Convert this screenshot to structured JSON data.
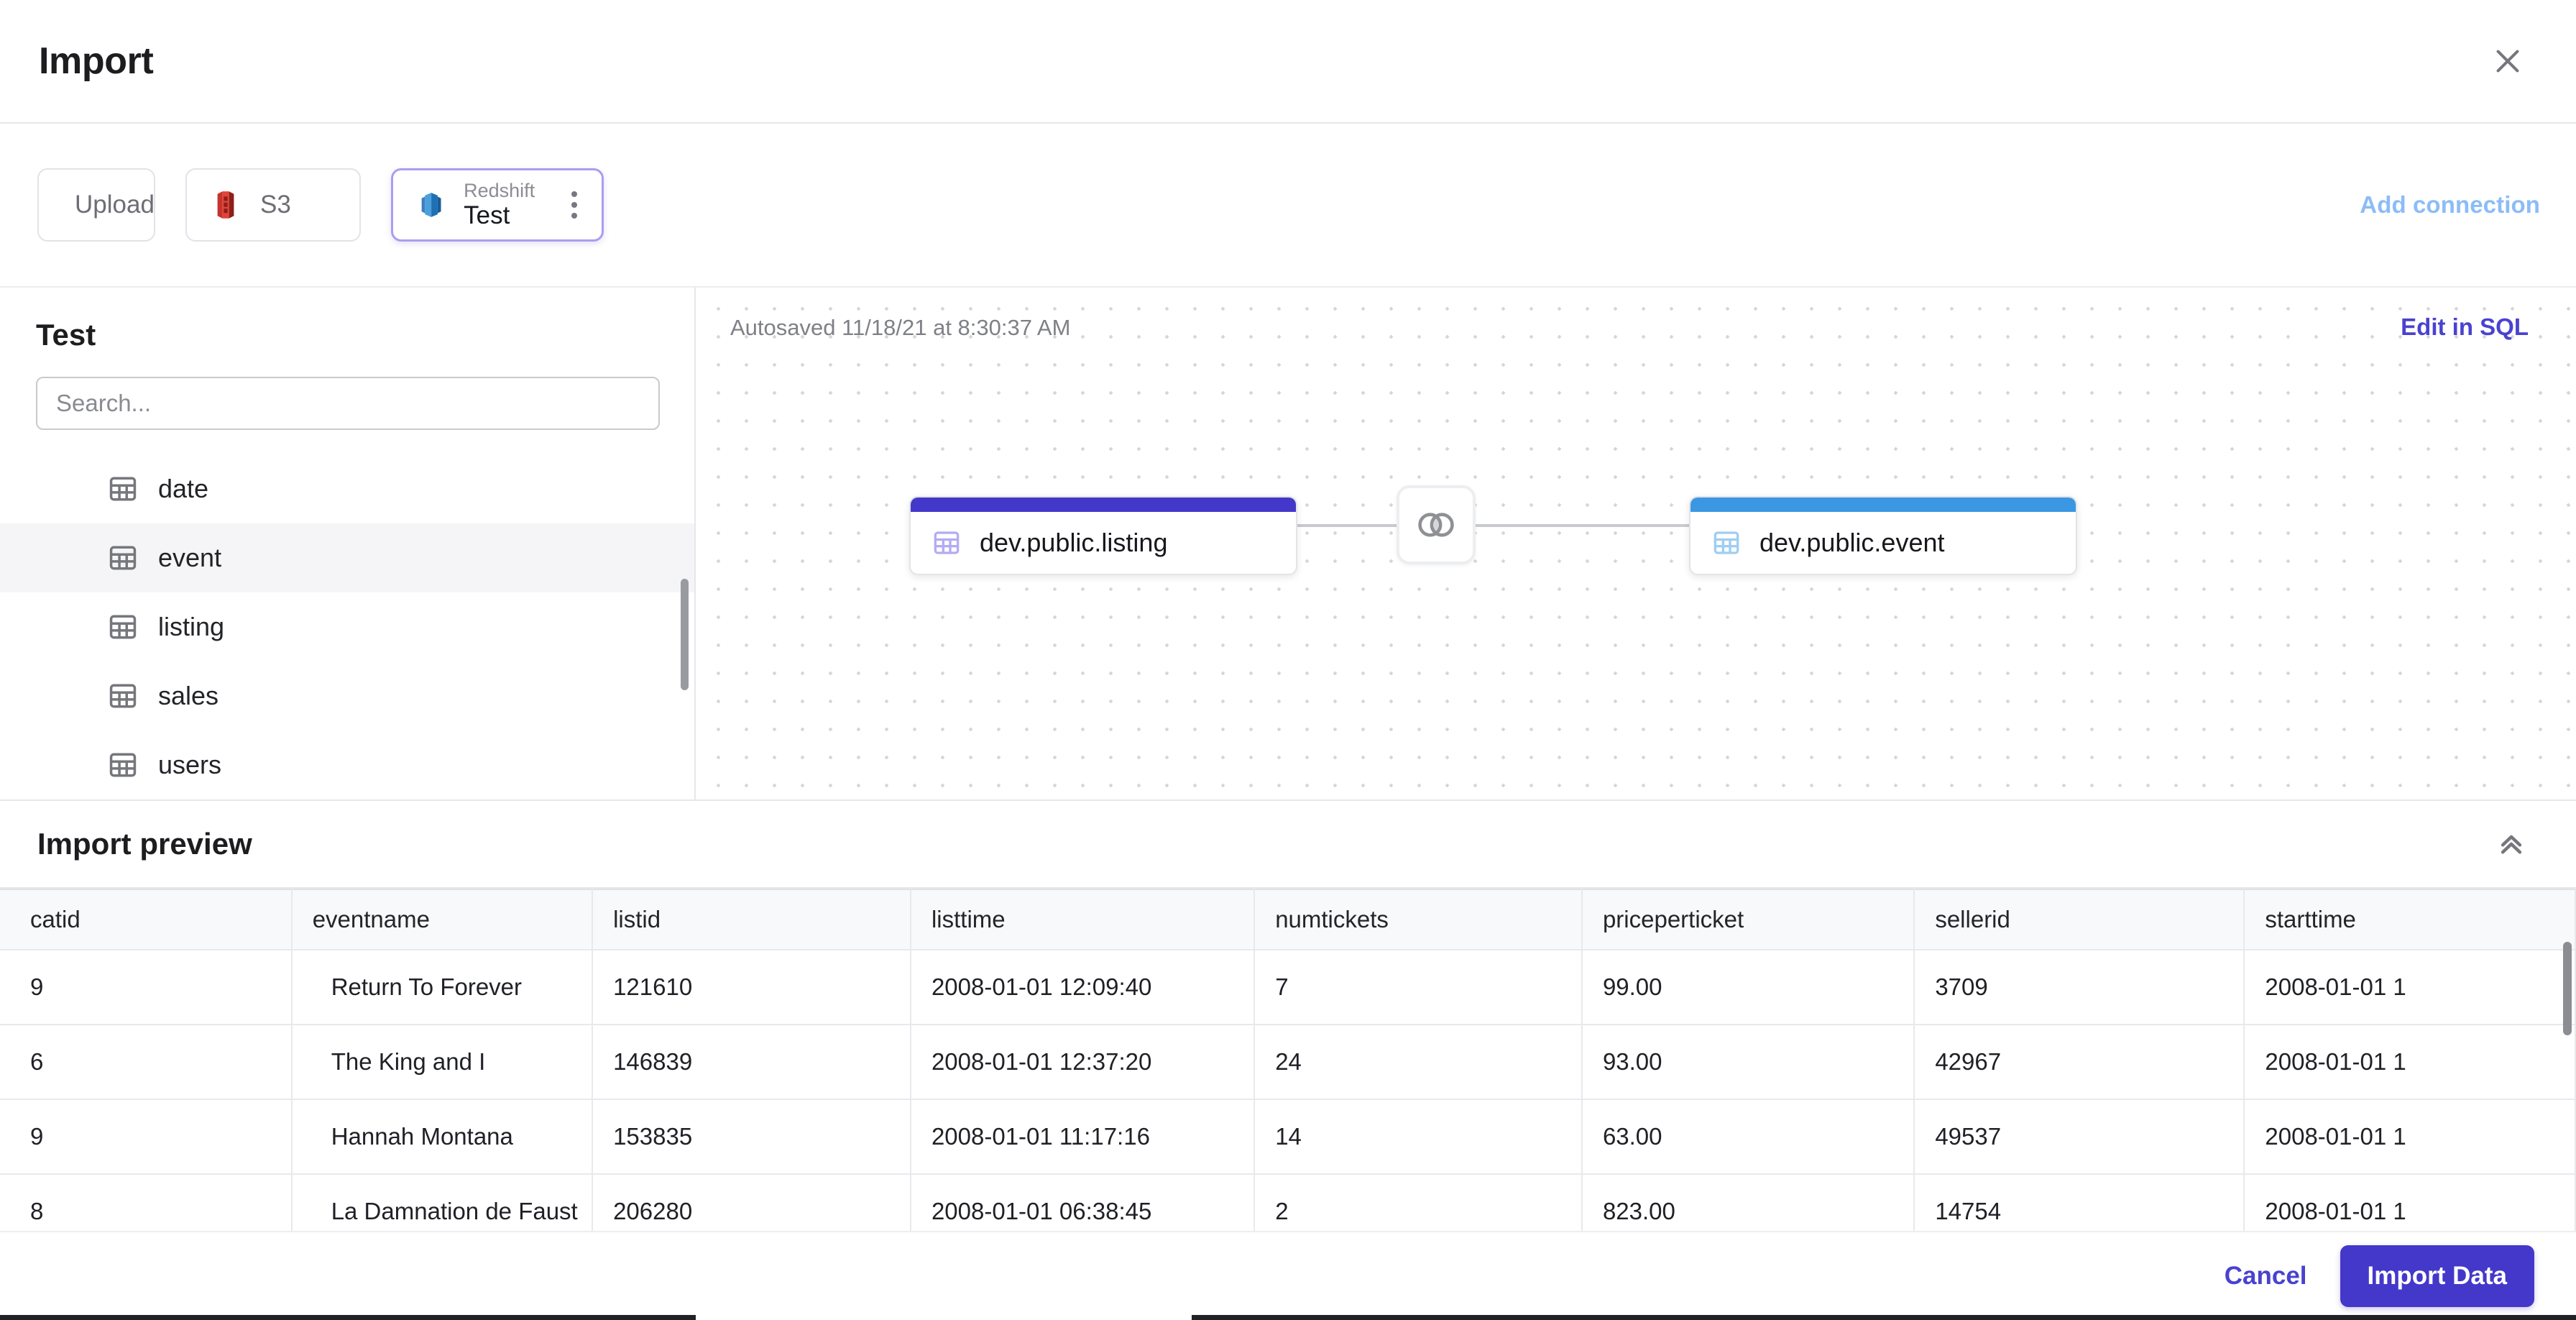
{
  "header": {
    "title": "Import",
    "close_icon": "close-icon"
  },
  "connections": {
    "add_connection_label": "Add connection",
    "tabs": [
      {
        "id": "upload",
        "label": "Upload",
        "icon": "cloud-upload-icon",
        "selected": false
      },
      {
        "id": "s3",
        "label": "S3",
        "icon": "aws-s3-icon",
        "selected": false
      },
      {
        "id": "redshift",
        "kind": "Redshift",
        "label": "Test",
        "icon": "aws-redshift-icon",
        "selected": true,
        "menu_icon": "kebab-menu-icon"
      }
    ]
  },
  "sidebar": {
    "title": "Test",
    "search_placeholder": "Search...",
    "search_value": "",
    "tables": [
      {
        "name": "date",
        "active": false
      },
      {
        "name": "event",
        "active": true
      },
      {
        "name": "listing",
        "active": false
      },
      {
        "name": "sales",
        "active": false
      },
      {
        "name": "users",
        "active": false
      }
    ]
  },
  "canvas": {
    "autosaved_text": "Autosaved 11/18/21 at 8:30:37 AM",
    "edit_sql_label": "Edit in SQL",
    "nodes": [
      {
        "id": "listing",
        "label": "dev.public.listing",
        "accent": "#4438ca",
        "icon": "table-icon"
      },
      {
        "id": "event",
        "label": "dev.public.event",
        "accent": "#3b97e2",
        "icon": "table-icon"
      }
    ],
    "join": {
      "icon": "inner-join-icon",
      "type": "inner"
    }
  },
  "preview": {
    "title": "Import preview",
    "collapse_icon": "double-chevron-up-icon",
    "columns": [
      "catid",
      "eventname",
      "listid",
      "listtime",
      "numtickets",
      "priceperticket",
      "sellerid",
      "starttime"
    ],
    "rows": [
      [
        "9",
        "Return To Forever",
        "121610",
        "2008-01-01 12:09:40",
        "7",
        "99.00",
        "3709",
        "2008-01-01 1"
      ],
      [
        "6",
        "The King and I",
        "146839",
        "2008-01-01 12:37:20",
        "24",
        "93.00",
        "42967",
        "2008-01-01 1"
      ],
      [
        "9",
        "Hannah Montana",
        "153835",
        "2008-01-01 11:17:16",
        "14",
        "63.00",
        "49537",
        "2008-01-01 1"
      ],
      [
        "8",
        "La Damnation de Faust",
        "206280",
        "2008-01-01 06:38:45",
        "2",
        "823.00",
        "14754",
        "2008-01-01 1"
      ]
    ]
  },
  "footer": {
    "cancel_label": "Cancel",
    "import_label": "Import Data"
  },
  "colors": {
    "primary": "#4438ca",
    "link_light_blue": "#8cbcf7",
    "accent_listing": "#4438ca",
    "accent_event": "#3b97e2",
    "selected_tab_border": "#a99ef0"
  }
}
